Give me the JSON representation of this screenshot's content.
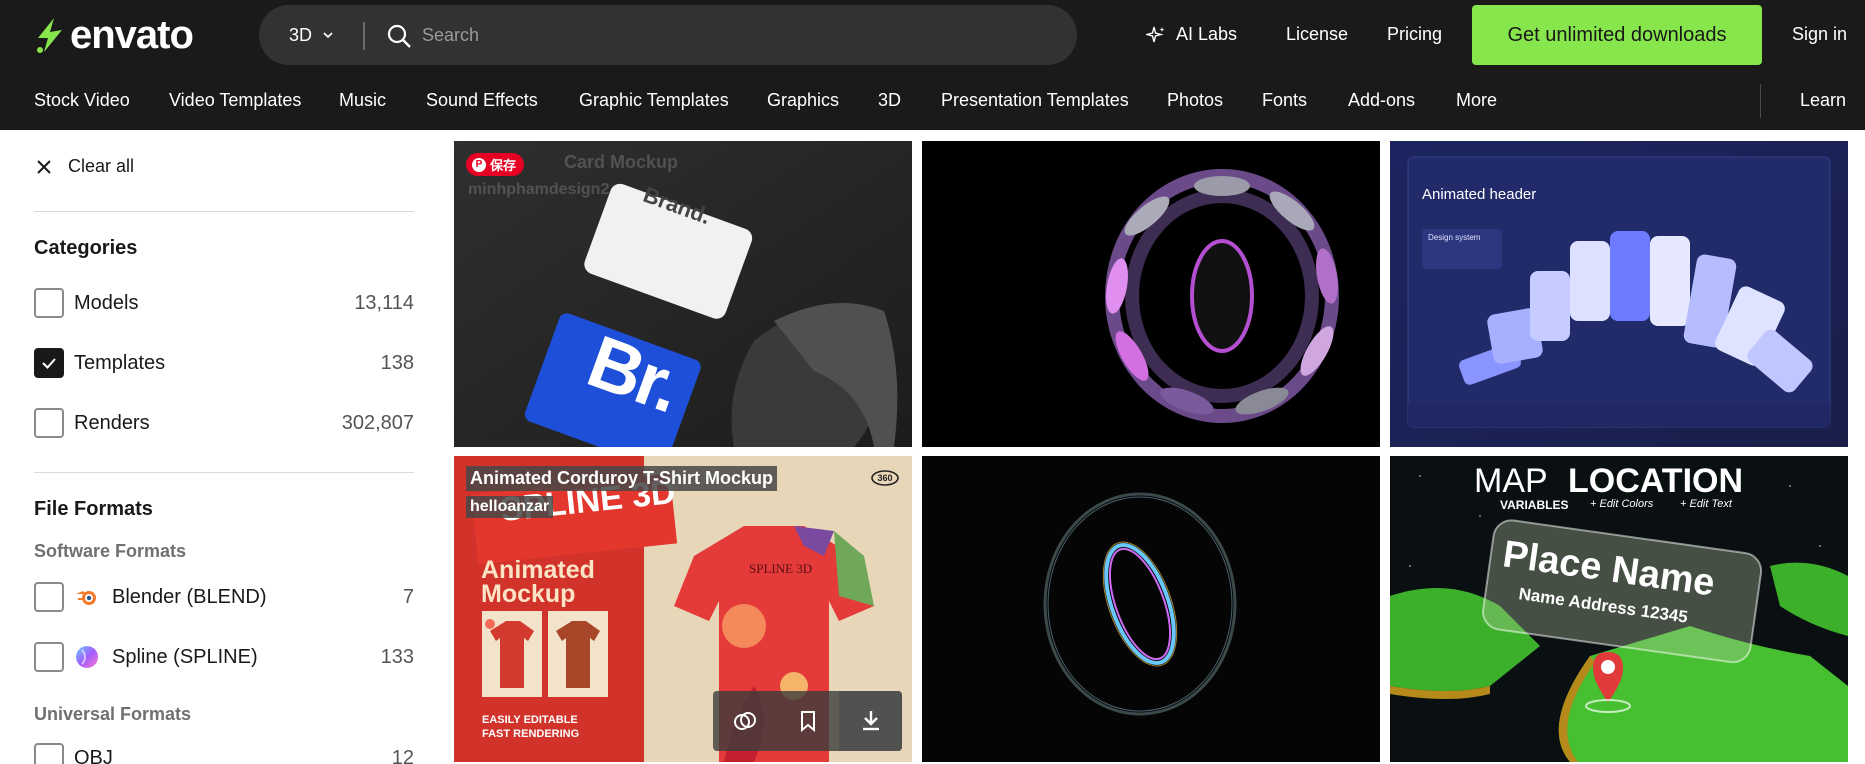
{
  "brand": {
    "name": "envato",
    "accent": "#87e64b"
  },
  "search": {
    "category": "3D",
    "placeholder": "Search"
  },
  "header": {
    "ai_labs": "AI Labs",
    "license": "License",
    "pricing": "Pricing",
    "cta": "Get unlimited downloads",
    "sign_in": "Sign in"
  },
  "nav": {
    "items": [
      "Stock Video",
      "Video Templates",
      "Music",
      "Sound Effects",
      "Graphic Templates",
      "Graphics",
      "3D",
      "Presentation Templates",
      "Photos",
      "Fonts",
      "Add-ons",
      "More"
    ],
    "learn": "Learn"
  },
  "sidebar": {
    "clear_all": "Clear all",
    "categories_title": "Categories",
    "categories": [
      {
        "label": "Models",
        "count": "13,114",
        "checked": false
      },
      {
        "label": "Templates",
        "count": "138",
        "checked": true
      },
      {
        "label": "Renders",
        "count": "302,807",
        "checked": false
      }
    ],
    "file_formats_title": "File Formats",
    "software_formats_title": "Software Formats",
    "software_formats": [
      {
        "label": "Blender (BLEND)",
        "count": "7",
        "icon": "blender-icon"
      },
      {
        "label": "Spline (SPLINE)",
        "count": "133",
        "icon": "spline-icon"
      }
    ],
    "universal_formats_title": "Universal Formats",
    "universal_formats": [
      {
        "label": "OBJ",
        "count": "12"
      }
    ]
  },
  "cards": [
    {
      "title": "",
      "author": "",
      "pin_label": "保存",
      "ghost_title": "Card Mockup",
      "ghost_author": "minhphamdesign2",
      "art_text_1": "Brand.",
      "art_text_2": "Br."
    },
    {
      "title": "",
      "author": ""
    },
    {
      "title": "",
      "author": "",
      "art_heading": "Animated header",
      "art_sub": "Design system"
    },
    {
      "title": "Animated Corduroy T-Shirt Mockup",
      "author": "helloanzar",
      "art_text_1": "SPLINE 3D",
      "art_text_2": "Animated",
      "art_text_3": "Mockup",
      "art_text_4": "EASILY EDITABLE",
      "art_text_5": "FAST RENDERING",
      "shirt_text": "SPLINE 3D"
    },
    {
      "title": "",
      "author": ""
    },
    {
      "title": "",
      "author": "",
      "art_heading_1": "MAP",
      "art_heading_2": "LOCATION",
      "art_sub_1": "VARIABLES",
      "art_sub_2": "+ Edit Colors",
      "art_sub_3": "+ Edit Text",
      "place": "Place Name",
      "address": "Name Address 12345"
    }
  ]
}
